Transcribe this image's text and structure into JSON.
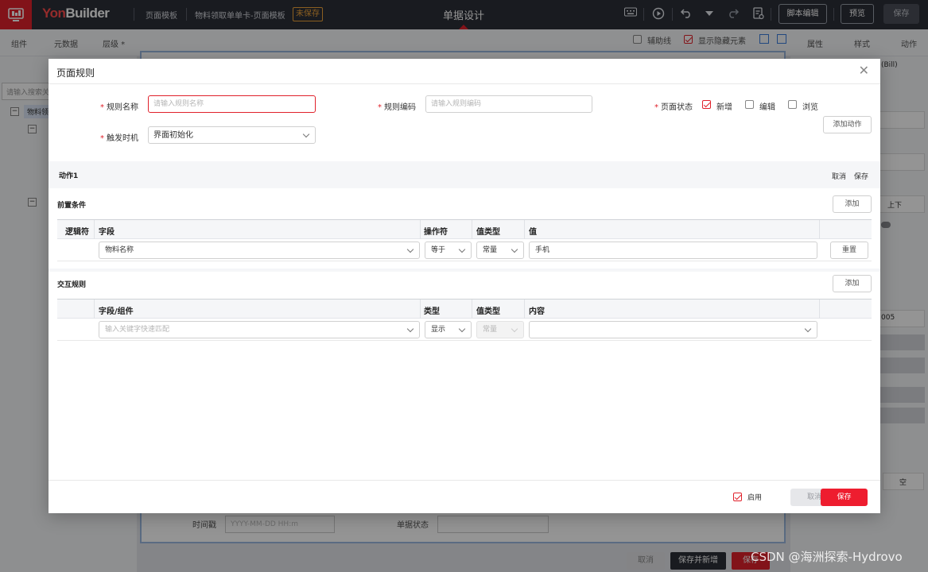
{
  "topbar": {
    "logo": "YonBuilder",
    "crumbs": [
      "页面模板",
      "物料领取单单卡-页面模板"
    ],
    "unsaved": "未保存",
    "page_title": "单据设计",
    "script_edit": "脚本编辑",
    "preview": "预览",
    "save": "保存"
  },
  "subbar": {
    "tabs": [
      "组件",
      "元数据",
      "层级 *"
    ],
    "aux_line": "辅助线",
    "show_hidden": "显示隐藏元素",
    "right_tabs": [
      "属性",
      "样式",
      "动作"
    ]
  },
  "background": {
    "search_placeholder": "请输入搜索关键字",
    "tree_root": "物料领",
    "bill_label": "(Bill)",
    "updown": "上下",
    "code_fragment": "005",
    "empty": "空",
    "timestamp_label": "时间戳",
    "timestamp_placeholder": "YYYY-MM-DD HH:m",
    "doc_status": "单据状态",
    "cancel": "取消",
    "save_and_new": "保存并新增",
    "save": "保存"
  },
  "watermark": "CSDN @海洲探索-Hydrovo",
  "modal": {
    "title": "页面规则",
    "rule_name_label": "规则名称",
    "rule_name_placeholder": "请输入规则名称",
    "rule_code_label": "规则编码",
    "rule_code_placeholder": "请输入规则编码",
    "page_state_label": "页面状态",
    "states": [
      {
        "label": "新增",
        "checked": true
      },
      {
        "label": "编辑",
        "checked": false
      },
      {
        "label": "浏览",
        "checked": false
      }
    ],
    "trigger_label": "触发时机",
    "trigger_value": "界面初始化",
    "add_action": "添加动作",
    "action_title": "动作1",
    "action_cancel": "取消",
    "action_save": "保存",
    "precondition": {
      "title": "前置条件",
      "add": "添加",
      "columns": [
        "逻辑符",
        "字段",
        "操作符",
        "值类型",
        "值"
      ],
      "row": {
        "field": "物料名称",
        "operator": "等于",
        "value_type": "常量",
        "value": "手机",
        "reset": "重置"
      }
    },
    "interaction": {
      "title": "交互规则",
      "add": "添加",
      "columns": [
        "字段/组件",
        "类型",
        "值类型",
        "内容"
      ],
      "row": {
        "field_placeholder": "输入关键字快速匹配",
        "type": "显示",
        "value_type": "常量",
        "content": ""
      }
    },
    "footer": {
      "enable": "启用",
      "enabled": true,
      "cancel": "取消",
      "save": "保存"
    }
  }
}
